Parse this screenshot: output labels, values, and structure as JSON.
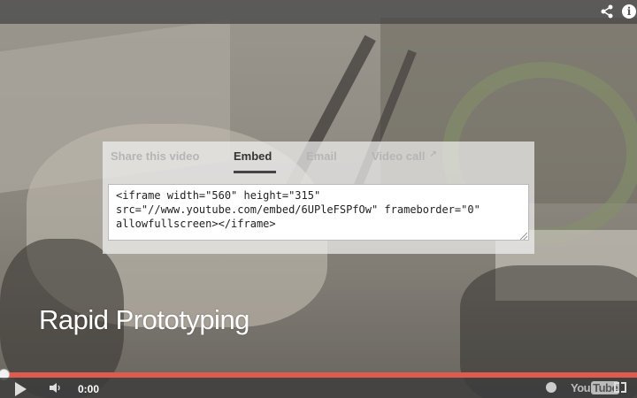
{
  "top_bar": {
    "share_icon": "share-icon",
    "info_icon": "info-icon",
    "info_glyph": "i"
  },
  "share_panel": {
    "tabs": [
      {
        "label": "Share this video",
        "active": false
      },
      {
        "label": "Embed",
        "active": true
      },
      {
        "label": "Email",
        "active": false
      },
      {
        "label": "Video call",
        "active": false,
        "icon": "external-link-icon"
      }
    ],
    "embed_code": "<iframe width=\"560\" height=\"315\"\nsrc=\"//www.youtube.com/embed/6UPleFSPfOw\" frameborder=\"0\"\nallowfullscreen></iframe>"
  },
  "video": {
    "title": "Rapid Prototyping",
    "progress": 0.0
  },
  "controls": {
    "time": "0:00",
    "logo_you": "You",
    "logo_tube": "Tube",
    "icons": [
      "play-icon",
      "volume-icon",
      "watch-later-icon",
      "youtube-logo",
      "fullscreen-icon"
    ]
  },
  "colors": {
    "progress_played": "#e05a4e",
    "controls_bg": "#3c3c3c"
  }
}
